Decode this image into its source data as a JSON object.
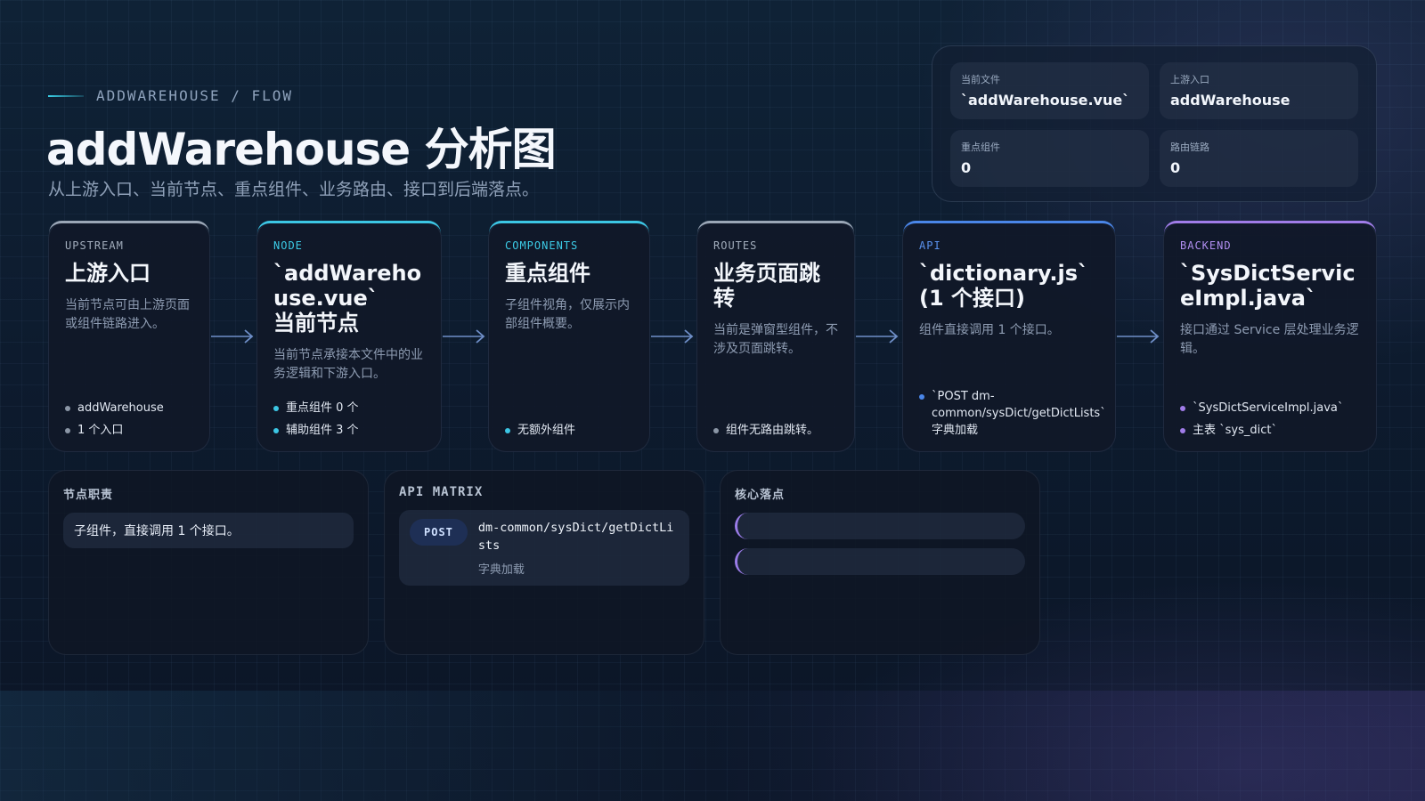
{
  "header": {
    "eyebrow": "ADDWAREHOUSE / FLOW",
    "title": "addWarehouse 分析图",
    "subtitle": "从上游入口、当前节点、重点组件、业务路由、接口到后端落点。"
  },
  "info": [
    {
      "label": "当前文件",
      "value": "`addWarehouse.vue`"
    },
    {
      "label": "上游入口",
      "value": "addWarehouse"
    },
    {
      "label": "重点组件",
      "value": "0"
    },
    {
      "label": "路由链路",
      "value": "0"
    }
  ],
  "cards": {
    "upstream": {
      "tag": "UPSTREAM",
      "title": "上游入口",
      "desc": "当前节点可由上游页面或组件链路进入。",
      "bullets": [
        "addWarehouse",
        "1 个入口"
      ]
    },
    "node": {
      "tag": "NODE",
      "title": "`addWarehouse.vue`",
      "title2": "当前节点",
      "desc": "当前节点承接本文件中的业务逻辑和下游入口。",
      "bullets": [
        "重点组件 0 个",
        "辅助组件 3 个"
      ]
    },
    "components": {
      "tag": "COMPONENTS",
      "title": "重点组件",
      "desc": "子组件视角，仅展示内部组件概要。",
      "bullets": [
        "无额外组件"
      ]
    },
    "routes": {
      "tag": "ROUTES",
      "title": "业务页面跳转",
      "desc": "当前是弹窗型组件，不涉及页面跳转。",
      "bullets": [
        "组件无路由跳转。"
      ]
    },
    "api": {
      "tag": "API",
      "title": "`dictionary.js` (1 个接口)",
      "desc": "组件直接调用 1 个接口。",
      "bullets": [
        "`POST dm-common/sysDict/getDictLists` 字典加载"
      ]
    },
    "backend": {
      "tag": "BACKEND",
      "title": "`SysDictServiceImpl.java`",
      "desc": "接口通过 Service 层处理业务逻辑。",
      "bullets": [
        "`SysDictServiceImpl.java`",
        "主表 `sys_dict`"
      ]
    }
  },
  "panels": {
    "duty": {
      "title": "节点职责",
      "text": "子组件，直接调用 1 个接口。"
    },
    "api_matrix": {
      "title": "API MATRIX",
      "rows": [
        {
          "method": "POST",
          "path": "dm-common/sysDict/getDictLists",
          "desc": "字典加载"
        }
      ]
    },
    "core": {
      "title": "核心落点"
    }
  }
}
